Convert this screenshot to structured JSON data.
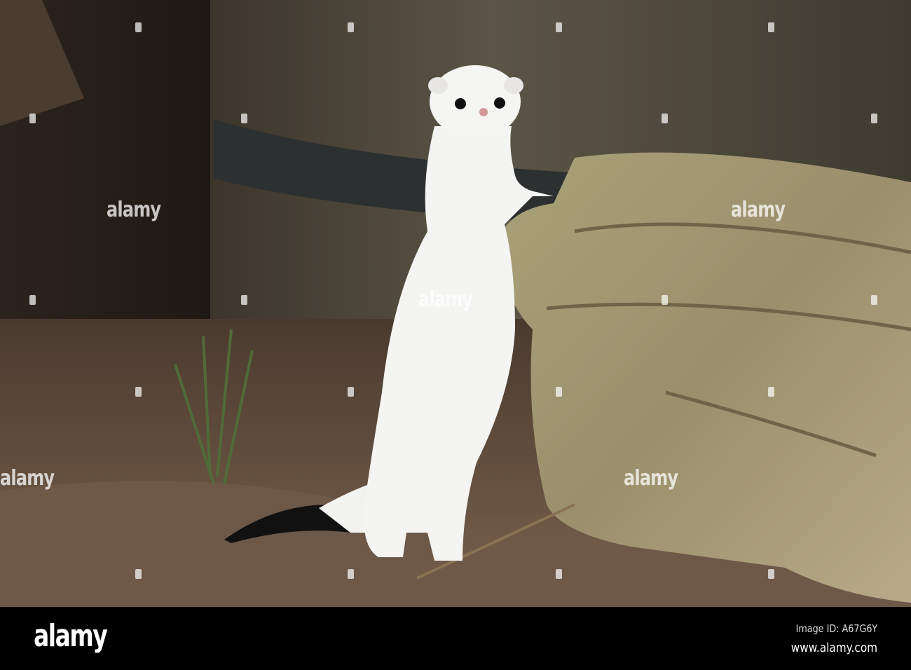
{
  "photo": {
    "subject": "white stoat (ermine) standing against a log beside a wooden barrel",
    "colors": {
      "background": "#2a231c",
      "barrel": "#4a4338",
      "log": "#a39a72",
      "ground": "#6b5544",
      "fur": "#f4f4f2",
      "tail_tip": "#111111"
    }
  },
  "watermark": {
    "text": "alamy"
  },
  "footer": {
    "logo": "alamy",
    "image_id": "Image ID: A67G6Y",
    "url": "www.alamy.com"
  }
}
